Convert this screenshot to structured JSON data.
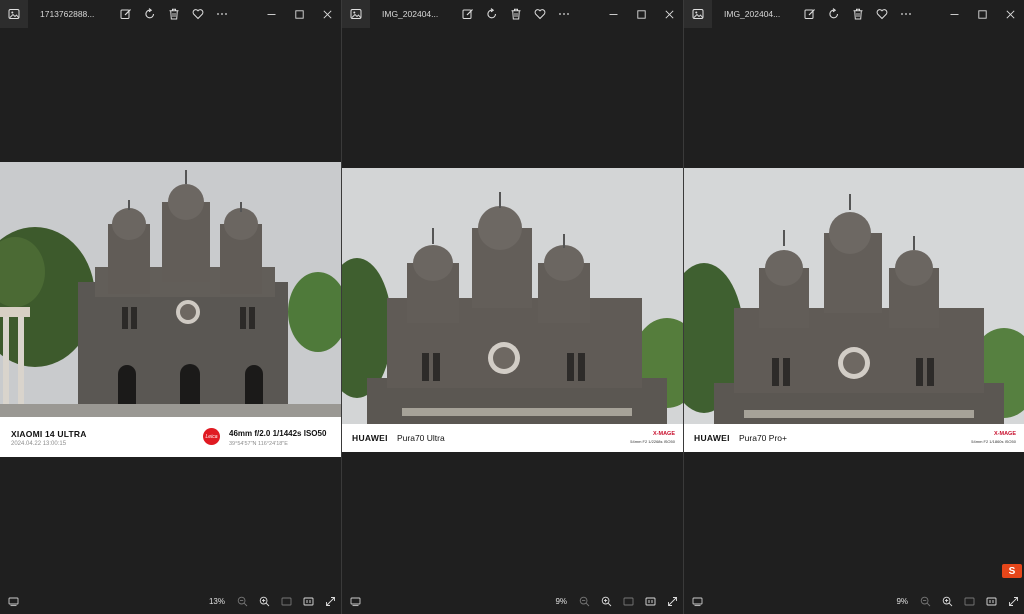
{
  "windows": [
    {
      "file_name": "1713762888...",
      "zoom": "13%",
      "watermark": {
        "type": "xiaomi",
        "model": "XIAOMI 14 ULTRA",
        "datetime": "2024.04.22  13:00:15",
        "lens_logo": "Leica",
        "params": "46mm  f/2.0  1/1442s  ISO50",
        "geo": "39°54'57\"N  116°24'18\"E"
      }
    },
    {
      "file_name": "IMG_202404...",
      "zoom": "9%",
      "watermark": {
        "type": "huawei",
        "brand": "HUAWEI",
        "model": "Pura70 Ultra",
        "badge": "X-MAGE",
        "params": "54mm  F2  1/2268s  ISO50"
      }
    },
    {
      "file_name": "IMG_202404...",
      "zoom": "9%",
      "watermark": {
        "type": "huawei",
        "brand": "HUAWEI",
        "model": "Pura70 Pro+",
        "badge": "X-MAGE",
        "params": "54mm  F2  1/1860s  ISO50"
      }
    }
  ],
  "toolbar_icons": [
    "edit-icon",
    "rotate-icon",
    "delete-icon",
    "favorite-icon",
    "more-icon"
  ],
  "window_controls": [
    "minimize-icon",
    "maximize-icon",
    "close-icon"
  ],
  "bottom_icons": [
    "filmstrip-icon",
    "zoom-out-icon",
    "zoom-in-icon",
    "fit-icon",
    "actual-size-icon",
    "fullscreen-icon"
  ],
  "site_logo": "S",
  "colors": {
    "background": "#1f1f1f",
    "leica_red": "#e01a22",
    "xmage_red": "#c8102e"
  }
}
